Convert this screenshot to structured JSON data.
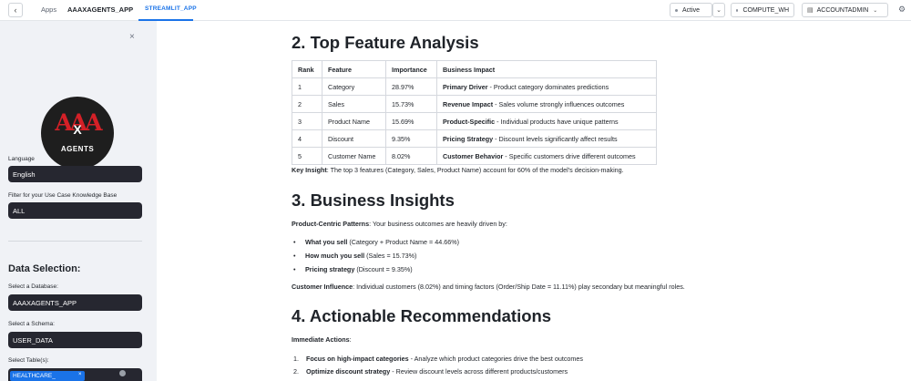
{
  "topbar": {
    "back_icon": "chevron-left-icon",
    "apps": "Apps",
    "app_name": "AAAXAGENTS_APP",
    "tab": "STREAMLIT_APP",
    "status": "Active",
    "warehouse": "COMPUTE_WH",
    "role": "ACCOUNTADMIN"
  },
  "sidebar": {
    "logo_text": "AAA",
    "logo_x": "X",
    "logo_word": "AGENTS",
    "language_label": "Language",
    "language_value": "English",
    "filter_label": "Filter for your Use Case Knowledge Base",
    "filter_value": "ALL",
    "data_selection": "Data Selection:",
    "database_label": "Select a Database:",
    "database_value": "AAAXAGENTS_APP",
    "schema_label": "Select a Schema:",
    "schema_value": "USER_DATA",
    "tables_label": "Select Table(s):",
    "table_tag": "HEALTHCARE_"
  },
  "main": {
    "section2_title": "2. Top Feature Analysis",
    "table_headers": [
      "Rank",
      "Feature",
      "Importance",
      "Business Impact"
    ],
    "rows": [
      {
        "rank": "1",
        "feature": "Category",
        "importance": "28.97%",
        "impact_bold": "Primary Driver",
        "impact_text": " - Product category dominates predictions"
      },
      {
        "rank": "2",
        "feature": "Sales",
        "importance": "15.73%",
        "impact_bold": "Revenue Impact",
        "impact_text": " - Sales volume strongly influences outcomes"
      },
      {
        "rank": "3",
        "feature": "Product Name",
        "importance": "15.69%",
        "impact_bold": "Product-Specific",
        "impact_text": " - Individual products have unique patterns"
      },
      {
        "rank": "4",
        "feature": "Discount",
        "importance": "9.35%",
        "impact_bold": "Pricing Strategy",
        "impact_text": " - Discount levels significantly affect results"
      },
      {
        "rank": "5",
        "feature": "Customer Name",
        "importance": "8.02%",
        "impact_bold": "Customer Behavior",
        "impact_text": " - Specific customers drive different outcomes"
      }
    ],
    "key_insight_bold": "Key Insight",
    "key_insight_text": ": The top 3 features (Category, Sales, Product Name) account for 60% of the model's decision-making.",
    "section3_title": "3. Business Insights",
    "pcp_bold": "Product-Centric Patterns",
    "pcp_text": ": Your business outcomes are heavily driven by:",
    "bullets": [
      {
        "bold": "What you sell",
        "text": " (Category + Product Name = 44.66%)"
      },
      {
        "bold": "How much you sell",
        "text": " (Sales = 15.73%)"
      },
      {
        "bold": "Pricing strategy",
        "text": " (Discount = 9.35%)"
      }
    ],
    "ci_bold": "Customer Influence",
    "ci_text": ": Individual customers (8.02%) and timing factors (Order/Ship Date = 11.11%) play secondary but meaningful roles.",
    "section4_title": "4. Actionable Recommendations",
    "immediate": "Immediate Actions",
    "immediate_colon": ":",
    "actions": [
      {
        "num": "1.",
        "bold": "Focus on high-impact categories",
        "text": " - Analyze which product categories drive the best outcomes"
      },
      {
        "num": "2.",
        "bold": "Optimize discount strategy",
        "text": " - Review discount levels across different products/customers"
      }
    ]
  }
}
